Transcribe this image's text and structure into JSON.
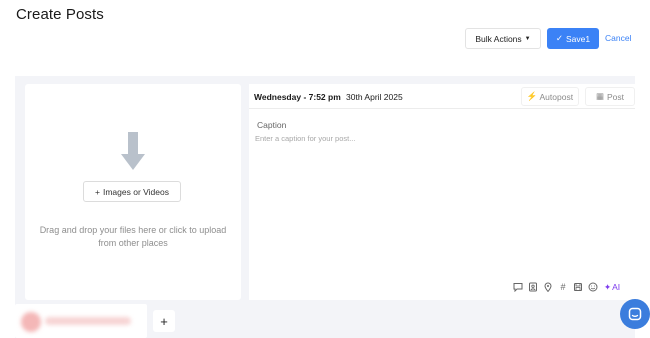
{
  "page": {
    "title": "Create Posts"
  },
  "header": {
    "bulk_actions_label": "Bulk Actions",
    "bulk_caret": "▼",
    "save_check": "✓",
    "save_label": "Save1",
    "cancel_label": "Cancel"
  },
  "upload": {
    "plus": "+",
    "button_label": "Images or Videos",
    "hint": "Drag and drop your files here or click to upload from other places"
  },
  "editor": {
    "day_time": "Wednesday - 7:52 pm",
    "date": "30th April 2025",
    "autopost_icon": "⚡",
    "autopost_label": "Autopost",
    "post_type_icon": "▦",
    "post_type_label": "Post",
    "caption_label": "Caption",
    "caption_placeholder": "Enter a caption for your post...",
    "caption_value": ""
  },
  "toolbar": {
    "hashtag": "#",
    "ai_sparkle": "✦",
    "ai_label": "AI"
  },
  "accounts": {
    "add_label": "+"
  },
  "colors": {
    "accent": "#3b82f6",
    "ai": "#7c3aed",
    "workspace_bg": "#f3f4f8",
    "chat": "#3b7ddd"
  }
}
